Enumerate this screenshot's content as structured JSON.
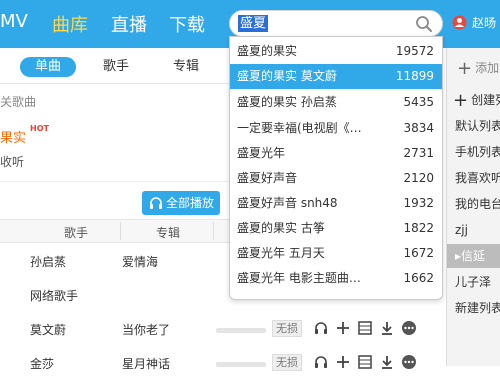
{
  "nav": {
    "items": [
      {
        "label": "MV"
      },
      {
        "label": "曲库",
        "active": true
      },
      {
        "label": "直播"
      },
      {
        "label": "下载"
      }
    ]
  },
  "search": {
    "value": "盛夏"
  },
  "user": {
    "name": "赵旸"
  },
  "tabs": [
    {
      "label": "单曲",
      "active": true
    },
    {
      "label": "歌手"
    },
    {
      "label": "专辑"
    }
  ],
  "main": {
    "section_title": "关歌曲",
    "highlight_song": "果实",
    "hot_badge": "HOT",
    "highlight_sub": "收听",
    "play_all": "全部播放",
    "columns": [
      "歌手",
      "专辑"
    ],
    "rows": [
      {
        "singer": "孙启蒸",
        "album": "爱情海",
        "badge": ""
      },
      {
        "singer": "网络歌手",
        "album": "",
        "badge": ""
      },
      {
        "singer": "莫文蔚",
        "album": "当你老了",
        "badge": "无损"
      },
      {
        "singer": "金莎",
        "album": "星月神话",
        "badge": "无损"
      }
    ]
  },
  "sidebar": {
    "add_label": "添加",
    "create_label": "创建列表",
    "items": [
      {
        "label": "默认列表"
      },
      {
        "label": "手机列表"
      },
      {
        "label": "我喜欢听"
      },
      {
        "label": "我的电台"
      },
      {
        "label": "zjj"
      },
      {
        "label": "信延",
        "active": true
      },
      {
        "label": "儿子泽"
      },
      {
        "label": "新建列表"
      }
    ]
  },
  "suggestions": [
    {
      "text": "盛夏的果实",
      "count": "19572"
    },
    {
      "text": "盛夏的果实   莫文蔚",
      "count": "11899",
      "selected": true
    },
    {
      "text": "盛夏的果实   孙启蒸",
      "count": "5435"
    },
    {
      "text": "一定要幸福(电视剧《…",
      "count": "3834"
    },
    {
      "text": "盛夏光年",
      "count": "2731"
    },
    {
      "text": "盛夏好声音",
      "count": "2120"
    },
    {
      "text": "盛夏好声音   snh48",
      "count": "1932"
    },
    {
      "text": "盛夏的果实   古筝",
      "count": "1822"
    },
    {
      "text": "盛夏光年   五月天",
      "count": "1672"
    },
    {
      "text": "盛夏光年   电影主题曲…",
      "count": "1662"
    }
  ],
  "colors": {
    "accent": "#31a9e9",
    "active_nav": "#ffd84a",
    "hot": "#ff6a00"
  }
}
